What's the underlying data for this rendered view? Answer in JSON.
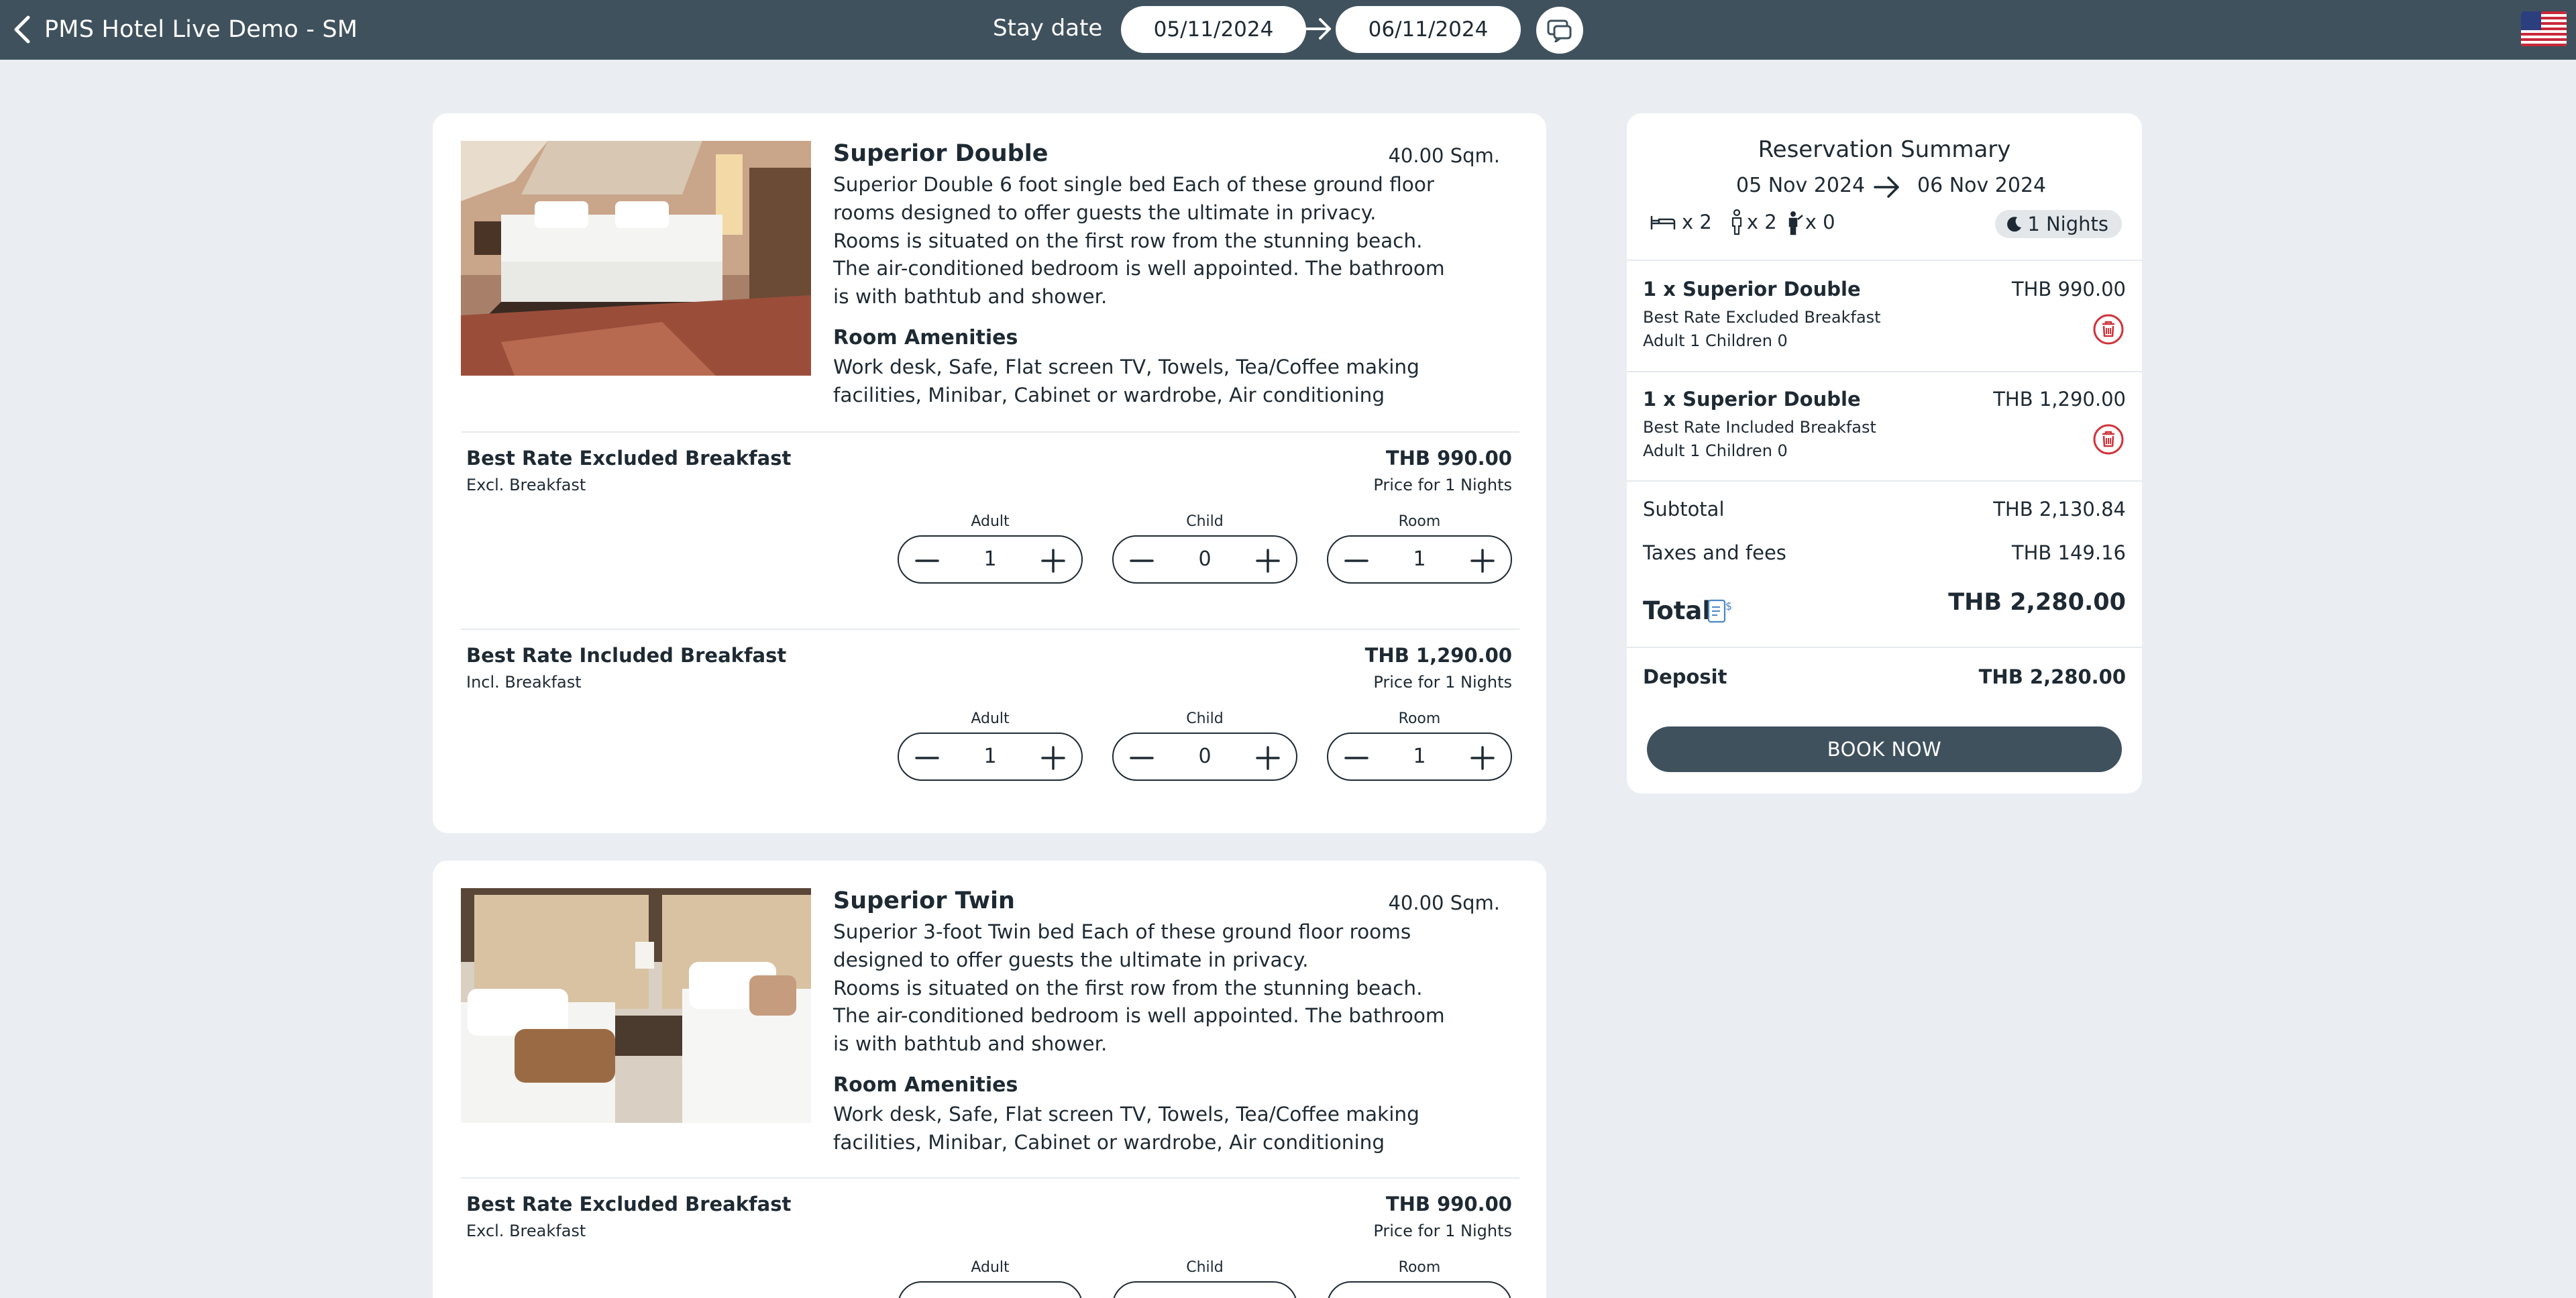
{
  "header": {
    "title": "PMS Hotel Live Demo - SM",
    "stay_date_label": "Stay date",
    "check_in": "05/11/2024",
    "check_out": "06/11/2024",
    "language_flag": "us-flag-icon"
  },
  "rooms": [
    {
      "name": "Superior Double",
      "size": "40.00 Sqm.",
      "description": "Superior Double 6 foot single bed Each of these ground floor rooms designed to offer guests the ultimate in privacy.\nRooms is situated on the first row from the stunning beach.\nThe air-conditioned bedroom is well appointed. The bathroom is with bathtub and shower.",
      "amenities_title": "Room Amenities",
      "amenities": "Work desk, Safe, Flat screen TV, Towels, Tea/Coffee making facilities, Minibar, Cabinet or wardrobe, Air conditioning",
      "rates": [
        {
          "name": "Best Rate Excluded Breakfast",
          "sub": "Excl. Breakfast",
          "price": "THB 990.00",
          "nights": "Price for 1 Nights",
          "adult_label": "Adult",
          "child_label": "Child",
          "room_label": "Room",
          "adult": "1",
          "child": "0",
          "room": "1"
        },
        {
          "name": "Best Rate Included Breakfast",
          "sub": "Incl. Breakfast",
          "price": "THB 1,290.00",
          "nights": "Price for 1 Nights",
          "adult_label": "Adult",
          "child_label": "Child",
          "room_label": "Room",
          "adult": "1",
          "child": "0",
          "room": "1"
        }
      ]
    },
    {
      "name": "Superior Twin",
      "size": "40.00 Sqm.",
      "description": "Superior 3-foot Twin bed Each of these ground floor rooms designed to offer guests the ultimate in privacy.\nRooms is situated on the first row from the stunning beach.\nThe air-conditioned bedroom is well appointed. The bathroom is with bathtub and shower.",
      "amenities_title": "Room Amenities",
      "amenities": "Work desk, Safe, Flat screen TV, Towels, Tea/Coffee making facilities, Minibar, Cabinet or wardrobe, Air conditioning",
      "rates": [
        {
          "name": "Best Rate Excluded Breakfast",
          "sub": "Excl. Breakfast",
          "price": "THB 990.00",
          "nights": "Price for 1 Nights",
          "adult_label": "Adult",
          "child_label": "Child",
          "room_label": "Room"
        }
      ]
    }
  ],
  "summary": {
    "title": "Reservation Summary",
    "check_in": "05 Nov 2024",
    "check_out": "06 Nov 2024",
    "beds": "x 2",
    "adults": "x 2",
    "children": "x 0",
    "nights": "1 Nights",
    "items": [
      {
        "name": "1 x Superior Double",
        "price": "THB 990.00",
        "rate": "Best Rate Excluded Breakfast",
        "occupancy": "Adult 1 Children 0"
      },
      {
        "name": "1 x Superior Double",
        "price": "THB 1,290.00",
        "rate": "Best Rate Included Breakfast",
        "occupancy": "Adult 1 Children 0"
      }
    ],
    "subtotal_label": "Subtotal",
    "subtotal": "THB 2,130.84",
    "taxes_label": "Taxes and fees",
    "taxes": "THB 149.16",
    "total_label": "Total",
    "total": "THB 2,280.00",
    "deposit_label": "Deposit",
    "deposit": "THB 2,280.00",
    "book_label": "BOOK NOW"
  },
  "colors": {
    "header_bg": "#3f515d",
    "page_bg": "#eaeef2",
    "delete_red": "#d0343a"
  }
}
